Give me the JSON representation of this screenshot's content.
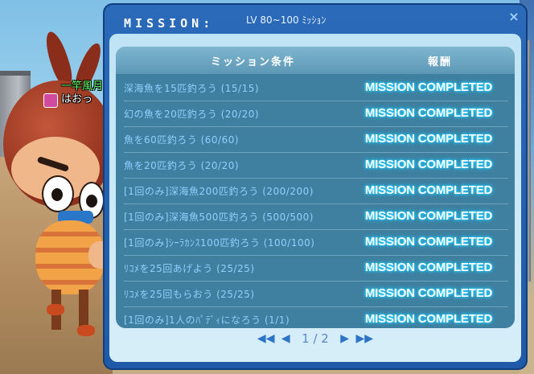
{
  "player": {
    "guild": "一竿風月",
    "name": "はおっ"
  },
  "window": {
    "title": "MISSION:",
    "subtitle": "LV 80~100 ﾐｯｼｮﾝ",
    "close_label": "×"
  },
  "table": {
    "headers": {
      "condition": "ミッション条件",
      "reward": "報酬"
    },
    "rows": [
      {
        "condition": "深海魚を15匹釣ろう (15/15)",
        "status": "MISSION COMPLETED"
      },
      {
        "condition": "幻の魚を20匹釣ろう (20/20)",
        "status": "MISSION COMPLETED"
      },
      {
        "condition": "魚を60匹釣ろう (60/60)",
        "status": "MISSION COMPLETED"
      },
      {
        "condition": "魚を20匹釣ろう (20/20)",
        "status": "MISSION COMPLETED"
      },
      {
        "condition": "[1回のみ]深海魚200匹釣ろう (200/200)",
        "status": "MISSION COMPLETED"
      },
      {
        "condition": "[1回のみ]深海魚500匹釣ろう (500/500)",
        "status": "MISSION COMPLETED"
      },
      {
        "condition": "[1回のみ]ｼｰﾗｶﾝｽ100匹釣ろう (100/100)",
        "status": "MISSION COMPLETED"
      },
      {
        "condition": "ﾘｺﾒを25回あげよう (25/25)",
        "status": "MISSION COMPLETED"
      },
      {
        "condition": "ﾘｺﾒを25回もらおう (25/25)",
        "status": "MISSION COMPLETED"
      },
      {
        "condition": "[1回のみ]1人のﾊﾟﾃﾞｨになろう (1/1)",
        "status": "MISSION COMPLETED"
      }
    ]
  },
  "pager": {
    "first": "◀◀",
    "prev": "◀",
    "text": "1 / 2",
    "next": "▶",
    "last": "▶▶"
  },
  "colors": {
    "window_frame": "#1e5aa8",
    "panel": "#3f7fa0",
    "condition_text": "#8fd0ff",
    "status_glow": "#27d3ff"
  }
}
